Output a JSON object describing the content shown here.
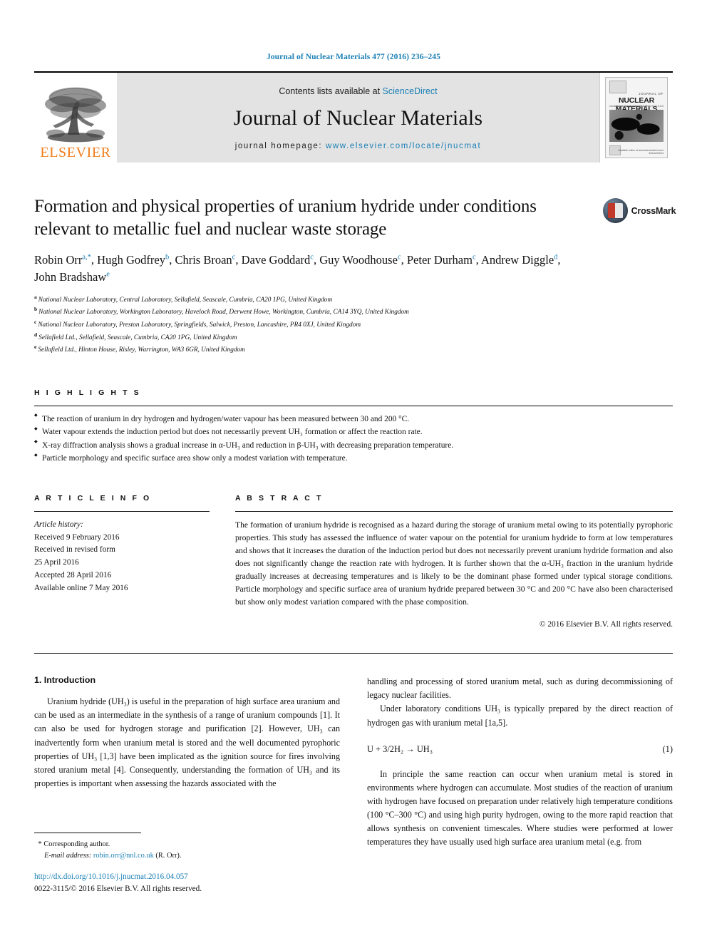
{
  "running_head": "Journal of Nuclear Materials 477 (2016) 236–245",
  "masthead": {
    "publisher_name": "ELSEVIER",
    "contents_prefix": "Contents lists available at ",
    "contents_link": "ScienceDirect",
    "journal_name": "Journal of Nuclear Materials",
    "homepage_prefix": "journal homepage: ",
    "homepage_url": "www.elsevier.com/locate/jnucmat",
    "cover": {
      "journal_of": "JOURNAL OF",
      "title": "NUCLEAR MATERIALS",
      "left_caption": "www.elsevier.com/locate/jnucmat",
      "right_caption": "Volume 477  October 2016  ISSN 0022-3115",
      "footer_caption": "Available online at\nwww.sciencedirect.com\nScienceDirect"
    }
  },
  "article": {
    "title": "Formation and physical properties of uranium hydride under conditions relevant to metallic fuel and nuclear waste storage",
    "crossmark_label": "CrossMark",
    "authors": [
      {
        "name": "Robin Orr",
        "marks": "a,*"
      },
      {
        "name": "Hugh Godfrey",
        "marks": "b"
      },
      {
        "name": "Chris Broan",
        "marks": "c"
      },
      {
        "name": "Dave Goddard",
        "marks": "c"
      },
      {
        "name": "Guy Woodhouse",
        "marks": "c"
      },
      {
        "name": "Peter Durham",
        "marks": "c"
      },
      {
        "name": "Andrew Diggle",
        "marks": "d"
      },
      {
        "name": "John Bradshaw",
        "marks": "e"
      }
    ],
    "affiliations": [
      {
        "mark": "a",
        "text": "National Nuclear Laboratory, Central Laboratory, Sellafield, Seascale, Cumbria, CA20 1PG, United Kingdom"
      },
      {
        "mark": "b",
        "text": "National Nuclear Laboratory, Workington Laboratory, Havelock Road, Derwent Howe, Workington, Cumbria, CA14 3YQ, United Kingdom"
      },
      {
        "mark": "c",
        "text": "National Nuclear Laboratory, Preston Laboratory, Springfields, Salwick, Preston, Lancashire, PR4 0XJ, United Kingdom"
      },
      {
        "mark": "d",
        "text": "Sellafield Ltd., Sellafield, Seascale, Cumbria, CA20 1PG, United Kingdom"
      },
      {
        "mark": "e",
        "text": "Sellafield Ltd., Hinton House, Risley, Warrington, WA3 6GR, United Kingdom"
      }
    ]
  },
  "highlights": {
    "label": "H I G H L I G H T S",
    "items": [
      "The reaction of uranium in dry hydrogen and hydrogen/water vapour has been measured between 30 and 200 °C.",
      "Water vapour extends the induction period but does not necessarily prevent UH₃ formation or affect the reaction rate.",
      "X-ray diffraction analysis shows a gradual increase in α-UH₃ and reduction in β-UH₃ with decreasing preparation temperature.",
      "Particle morphology and specific surface area show only a modest variation with temperature."
    ]
  },
  "article_info": {
    "label": "A R T I C L E   I N F O",
    "history_title": "Article history:",
    "history_lines": [
      "Received 9 February 2016",
      "Received in revised form",
      "25 April 2016",
      "Accepted 28 April 2016",
      "Available online 7 May 2016"
    ]
  },
  "abstract": {
    "label": "A B S T R A C T",
    "body": "The formation of uranium hydride is recognised as a hazard during the storage of uranium metal owing to its potentially pyrophoric properties. This study has assessed the influence of water vapour on the potential for uranium hydride to form at low temperatures and shows that it increases the duration of the induction period but does not necessarily prevent uranium hydride formation and also does not significantly change the reaction rate with hydrogen. It is further shown that the α-UH₃ fraction in the uranium hydride gradually increases at decreasing temperatures and is likely to be the dominant phase formed under typical storage conditions. Particle morphology and specific surface area of uranium hydride prepared between 30 °C and 200 °C have also been characterised but show only modest variation compared with the phase composition.",
    "copyright": "© 2016 Elsevier B.V. All rights reserved."
  },
  "introduction": {
    "heading": "1. Introduction",
    "left_para_1_a": "Uranium hydride (UH",
    "left_para_1": "Uranium hydride (UH₃) is useful in the preparation of high surface area uranium and can be used as an intermediate in the synthesis of a range of uranium compounds [1]. It can also be used for hydrogen storage and purification [2]. However, UH₃ can inadvertently form when uranium metal is stored and the well documented pyrophoric properties of UH₃ [1,3] have been implicated as the ignition source for fires involving stored uranium metal [4]. Consequently, understanding the formation of UH₃ and its properties is important when assessing the hazards associated with the",
    "right_para_1": "handling and processing of stored uranium metal, such as during decommissioning of legacy nuclear facilities.",
    "right_para_2": "Under laboratory conditions UH₃ is typically prepared by the direct reaction of hydrogen gas with uranium metal [1a,5].",
    "equation_text": "U + 3/2H₂ → UH₃",
    "equation_number": "(1)",
    "right_para_3": "In principle the same reaction can occur when uranium metal is stored in environments where hydrogen can accumulate. Most studies of the reaction of uranium with hydrogen have focused on preparation under relatively high temperature conditions (100 °C–300 °C) and using high purity hydrogen, owing to the more rapid reaction that allows synthesis on convenient timescales. Where studies were performed at lower temperatures they have usually used high surface area uranium metal (e.g. from"
  },
  "footer": {
    "corresponding_star": "*",
    "corresponding_label": "Corresponding author.",
    "email_label": "E-mail address:",
    "email": "robin.orr@nnl.co.uk",
    "email_suffix": "(R. Orr).",
    "doi": "http://dx.doi.org/10.1016/j.jnucmat.2016.04.057",
    "issn": "0022-3115/© 2016 Elsevier B.V. All rights reserved."
  },
  "colors": {
    "link_blue": "#1a7fb5",
    "elsevier_orange": "#f07c1a",
    "band_gray": "#e3e3e3"
  }
}
